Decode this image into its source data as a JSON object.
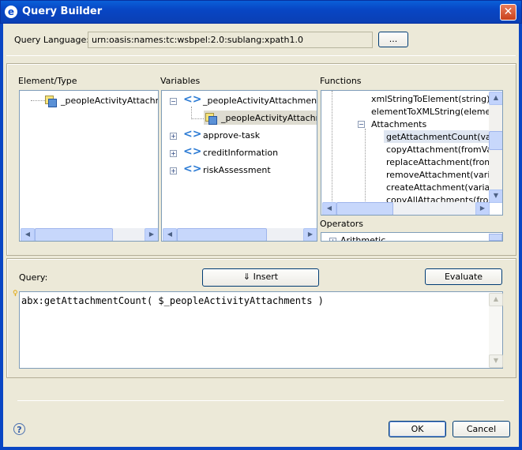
{
  "window": {
    "title": "Query Builder",
    "app_icon": "eclipse-icon",
    "close_glyph": "✕"
  },
  "query_language": {
    "label": "Query Language:",
    "value": "urn:oasis:names:tc:wsbpel:2.0:sublang:xpath1.0",
    "browse_label": "..."
  },
  "element_type": {
    "label": "Element/Type",
    "items": [
      {
        "label": "_peopleActivityAttachmer"
      }
    ]
  },
  "variables": {
    "label": "Variables",
    "items": [
      {
        "label": "_peopleActivityAttachments",
        "expander": "−"
      },
      {
        "label": "_peopleActivityAttachmer"
      },
      {
        "label": "approve-task",
        "expander": "+"
      },
      {
        "label": "creditInformation",
        "expander": "+"
      },
      {
        "label": "riskAssessment",
        "expander": "+"
      }
    ]
  },
  "functions": {
    "label": "Functions",
    "items": [
      {
        "label": "xmlStringToElement(string)"
      },
      {
        "label": "elementToXMLString(element)"
      },
      {
        "label": "Attachments",
        "expander": "−"
      },
      {
        "label": "getAttachmentCount(varia"
      },
      {
        "label": "copyAttachment(fromVaria"
      },
      {
        "label": "replaceAttachment(fromVa"
      },
      {
        "label": "removeAttachment(variabl"
      },
      {
        "label": "createAttachment(variable"
      },
      {
        "label": "copyAllAttachments(fromVa"
      }
    ]
  },
  "operators": {
    "label": "Operators",
    "first_item": "Arithmetic",
    "expander": "+"
  },
  "query": {
    "label": "Query:",
    "insert_label": "⇓ Insert",
    "evaluate_label": "Evaluate",
    "text": "abx:getAttachmentCount( $_peopleActivityAttachments )"
  },
  "footer": {
    "help_glyph": "?",
    "ok_label": "OK",
    "cancel_label": "Cancel"
  },
  "colors": {
    "title_bar": "#0a46c4",
    "dialog_bg": "#ece9d8",
    "selection": "#dedcd1"
  }
}
